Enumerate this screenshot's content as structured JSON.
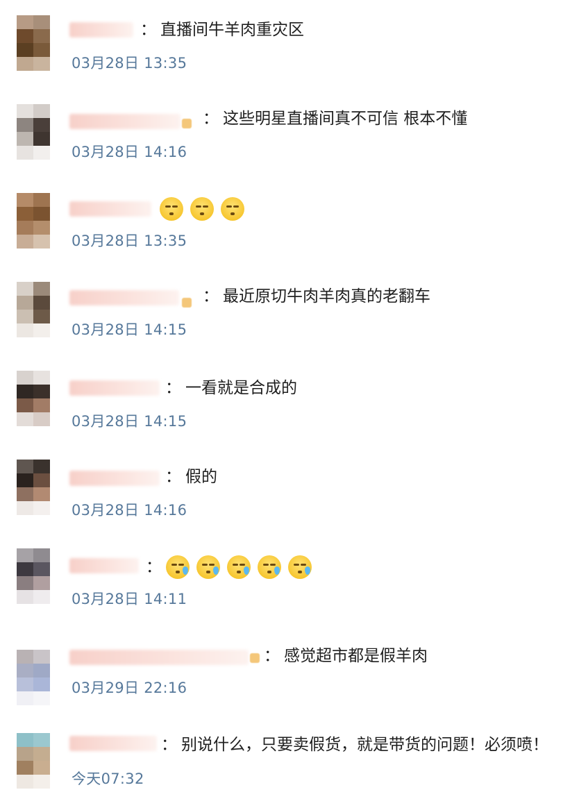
{
  "comments": [
    {
      "text": "直播间牛羊肉重灾区",
      "time": "03月28日 13:35"
    },
    {
      "text": "这些明星直播间真不可信 根本不懂",
      "time": "03月28日 14:16"
    },
    {
      "text": "",
      "time": "03月28日 13:35",
      "emojis": [
        "expressionless-face-icon",
        "expressionless-face-icon",
        "expressionless-face-icon"
      ]
    },
    {
      "text": "最近原切牛肉羊肉真的老翻车",
      "time": "03月28日 14:15"
    },
    {
      "text": "一看就是合成的",
      "time": "03月28日 14:15"
    },
    {
      "text": "假的",
      "time": "03月28日 14:16"
    },
    {
      "text": "",
      "time": "03月28日 14:11",
      "emojis": [
        "sweat-face-icon",
        "sweat-face-icon",
        "sweat-face-icon",
        "sweat-face-icon",
        "sweat-face-icon"
      ]
    },
    {
      "text": "感觉超市都是假羊肉",
      "time": "03月29日 22:16"
    },
    {
      "text": "别说什么，只要卖假货，就是带货的问题！必须喷！",
      "time": "今天07:32"
    }
  ],
  "separator": "："
}
